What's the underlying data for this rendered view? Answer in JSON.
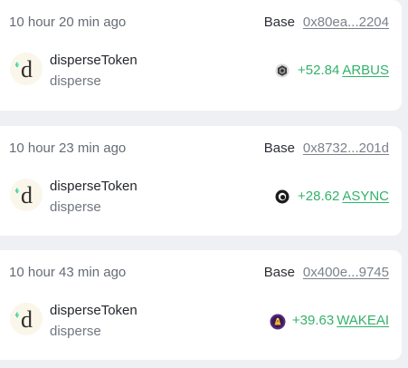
{
  "transactions": [
    {
      "time": "10 hour 20 min ago",
      "chain": "Base",
      "hash": "0x80ea...2204",
      "app_name": "disperseToken",
      "app_sub": "disperse",
      "amount": "+52.84",
      "token": "ARBUS",
      "token_icon": "arbus-token-icon"
    },
    {
      "time": "10 hour 23 min ago",
      "chain": "Base",
      "hash": "0x8732...201d",
      "app_name": "disperseToken",
      "app_sub": "disperse",
      "amount": "+28.62",
      "token": "ASYNC",
      "token_icon": "async-token-icon"
    },
    {
      "time": "10 hour 43 min ago",
      "chain": "Base",
      "hash": "0x400e...9745",
      "app_name": "disperseToken",
      "app_sub": "disperse",
      "amount": "+39.63",
      "token": "WAKEAI",
      "token_icon": "wakeai-token-icon"
    }
  ],
  "colors": {
    "positive": "#33b26b",
    "card": "#ffffff",
    "background": "#eef0f4"
  }
}
